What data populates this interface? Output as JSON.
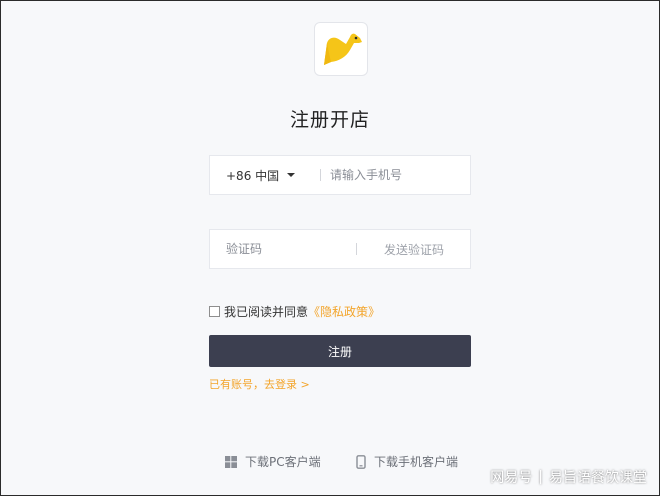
{
  "page": {
    "title": "注册开店"
  },
  "phone": {
    "country_code": "+86 中国",
    "placeholder": "请输入手机号"
  },
  "code": {
    "placeholder": "验证码",
    "send_label": "发送验证码"
  },
  "agreement": {
    "text": "我已阅读并同意",
    "policy_label": "《隐私政策》",
    "checked": false
  },
  "register": {
    "label": "注册"
  },
  "login": {
    "label": "已有账号，去登录 >"
  },
  "downloads": {
    "pc_label": "下载PC客户端",
    "mobile_label": "下载手机客户端"
  },
  "watermark": {
    "brand": "网易号",
    "separator": "|",
    "account": "易旨语餐饮课堂"
  },
  "colors": {
    "accent": "#f3a52b",
    "button": "#3c3f50",
    "logo": "#f5c518"
  },
  "icons": {
    "logo": "kangaroo-logo-icon",
    "country": "caret-down-icon",
    "pc": "windows-icon",
    "mobile": "phone-icon"
  }
}
